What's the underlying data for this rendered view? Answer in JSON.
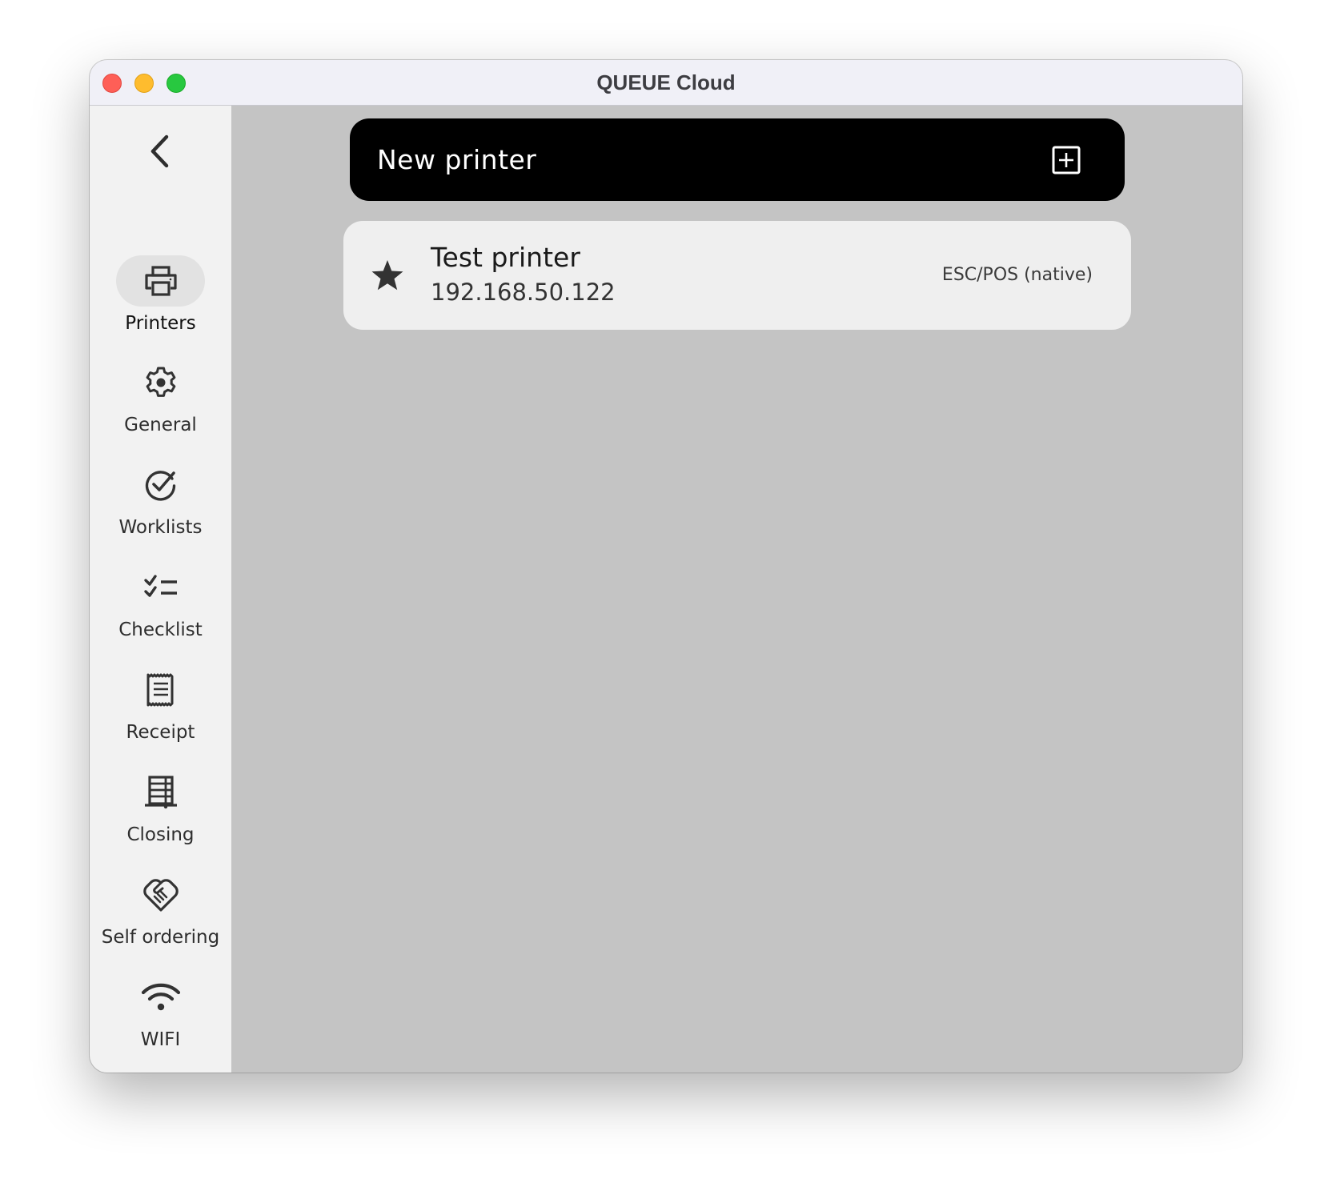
{
  "window": {
    "title": "QUEUE Cloud",
    "controls": [
      "close",
      "minimize",
      "maximize"
    ]
  },
  "sidebar": {
    "back_icon": "chevron-left-icon",
    "active": "Printers",
    "items": [
      {
        "label": "Printers",
        "icon": "printer-icon"
      },
      {
        "label": "General",
        "icon": "gear-icon"
      },
      {
        "label": "Worklists",
        "icon": "check-circle-icon"
      },
      {
        "label": "Checklist",
        "icon": "checklist-icon"
      },
      {
        "label": "Receipt",
        "icon": "receipt-icon"
      },
      {
        "label": "Closing",
        "icon": "closing-register-icon"
      },
      {
        "label": "Self ordering",
        "icon": "handshake-icon"
      },
      {
        "label": "WIFI",
        "icon": "wifi-icon"
      }
    ]
  },
  "main": {
    "new_printer_label": "New printer",
    "new_printer_icon": "plus-square-icon",
    "printers": [
      {
        "name": "Test printer",
        "address": "192.168.50.122",
        "type": "ESC/POS (native)",
        "default": true,
        "icon": "star-icon"
      }
    ]
  },
  "colors": {
    "titlebar_bg": "#f0f0f7",
    "sidebar_bg": "#f2f2f2",
    "content_bg": "#c4c4c4",
    "button_bg": "#000000",
    "card_bg": "#efefef",
    "active_pill": "#e2e2e2",
    "traffic_close": "#fe5f57",
    "traffic_minimize": "#febc2e",
    "traffic_maximize": "#28c840"
  }
}
